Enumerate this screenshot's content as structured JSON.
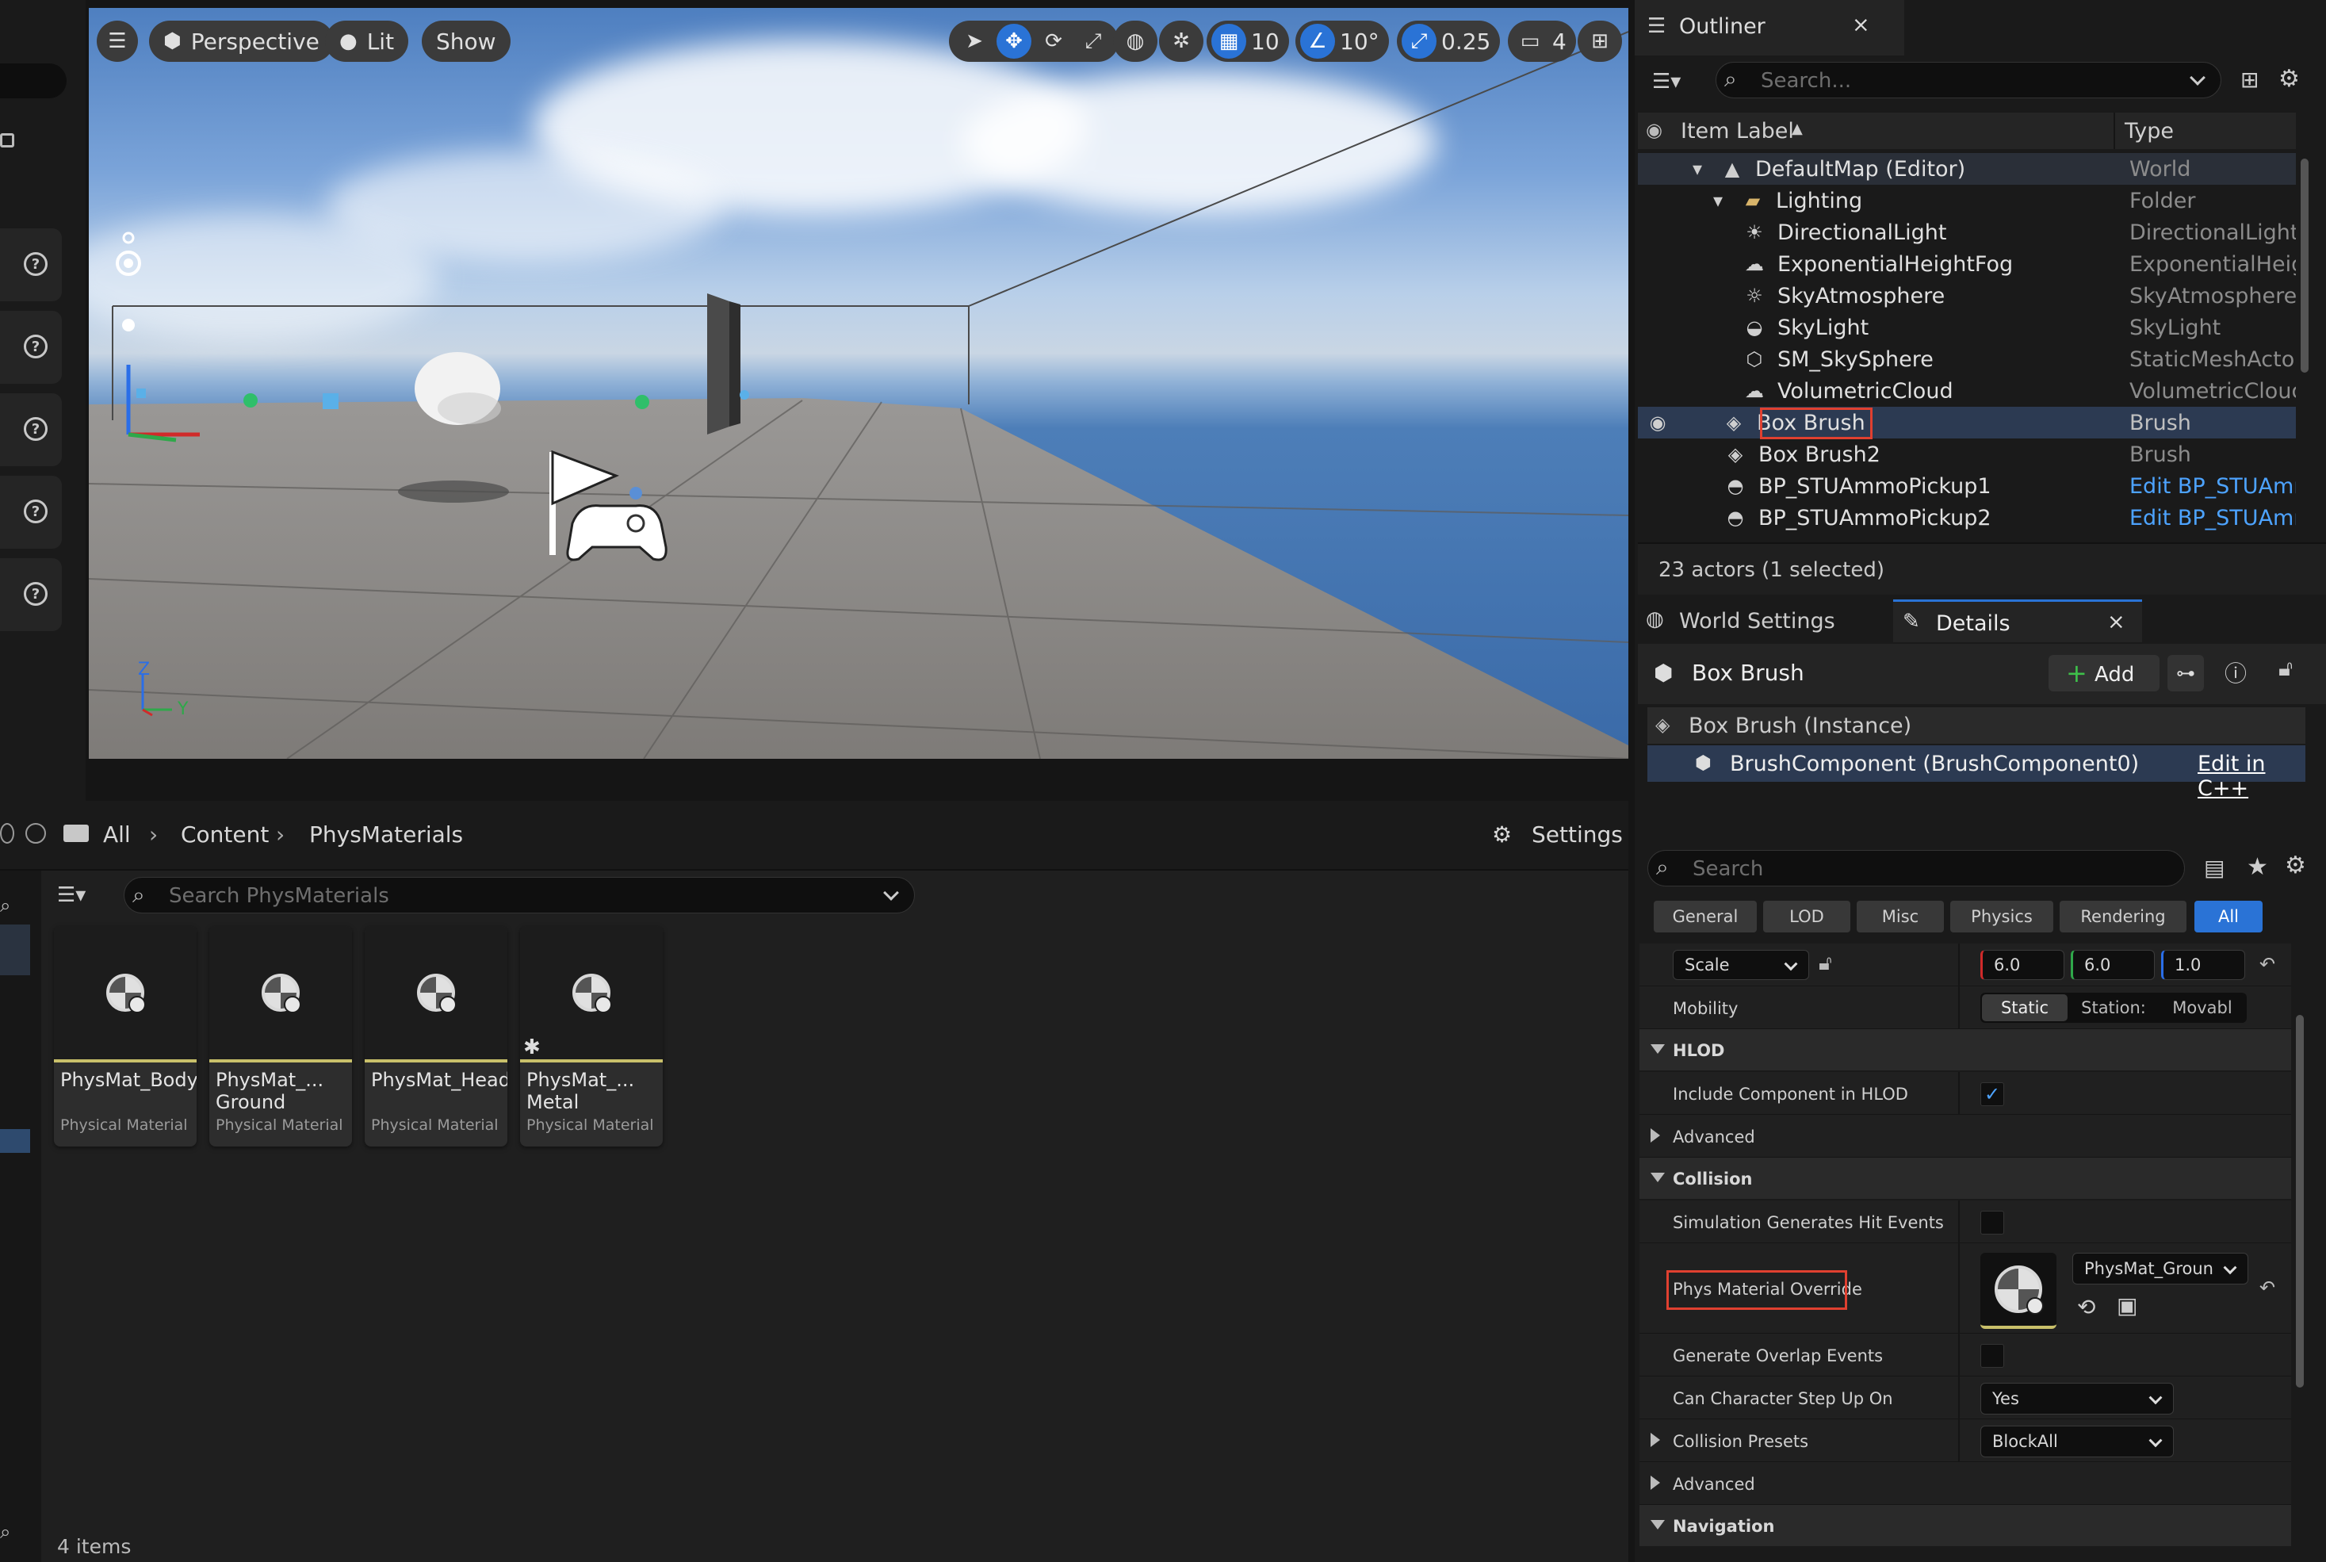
{
  "viewport": {
    "perspective_label": "Perspective",
    "lit_label": "Lit",
    "show_label": "Show",
    "grid_snap": "10",
    "rotation_snap": "10°",
    "scale_snap": "0.25",
    "camera_speed": "4",
    "axis_z": "Z",
    "axis_y": "Y"
  },
  "outliner": {
    "title": "Outliner",
    "search_placeholder": "Search...",
    "col_label": "Item Label",
    "col_type": "Type",
    "items": [
      {
        "label": "DefaultMap (Editor)",
        "type": "World",
        "icon": "map-icon"
      },
      {
        "label": "Lighting",
        "type": "Folder",
        "icon": "folder-icon"
      },
      {
        "label": "DirectionalLight",
        "type": "DirectionalLight",
        "icon": "sun-icon"
      },
      {
        "label": "ExponentialHeightFog",
        "type": "ExponentialHeigh",
        "icon": "fog-icon"
      },
      {
        "label": "SkyAtmosphere",
        "type": "SkyAtmosphere",
        "icon": "sky-icon"
      },
      {
        "label": "SkyLight",
        "type": "SkyLight",
        "icon": "skylight-icon"
      },
      {
        "label": "SM_SkySphere",
        "type": "StaticMeshActor",
        "icon": "mesh-icon"
      },
      {
        "label": "VolumetricCloud",
        "type": "VolumetricCloud",
        "icon": "cloud-icon"
      },
      {
        "label": "Box Brush",
        "type": "Brush",
        "icon": "brush-icon"
      },
      {
        "label": "Box Brush2",
        "type": "Brush",
        "icon": "brush-icon"
      },
      {
        "label": "BP_STUAmmoPickup1",
        "type": "Edit BP_STUAmn",
        "icon": "actor-icon"
      },
      {
        "label": "BP_STUAmmoPickup2",
        "type": "Edit BP_STUAmn",
        "icon": "actor-icon"
      }
    ],
    "status": "23 actors (1 selected)"
  },
  "tabs": {
    "world_settings": "World Settings",
    "details": "Details"
  },
  "details": {
    "actor_name": "Box Brush",
    "add_label": "Add",
    "instance_label": "Box Brush (Instance)",
    "component_label": "BrushComponent (BrushComponent0)",
    "edit_cpp": "Edit in C++",
    "search_placeholder": "Search",
    "filter_tabs": [
      "General",
      "LOD",
      "Misc",
      "Physics",
      "Rendering",
      "All"
    ],
    "scale_label": "Scale",
    "scale_x": "6.0",
    "scale_y": "6.0",
    "scale_z": "1.0",
    "mobility_label": "Mobility",
    "mobility_options": [
      "Static",
      "Station:",
      "Movabl"
    ],
    "hlod_section": "HLOD",
    "include_hlod": "Include Component in HLOD",
    "advanced": "Advanced",
    "collision_section": "Collision",
    "sim_hit_events": "Simulation Generates Hit Events",
    "phys_override": "Phys Material Override",
    "phys_value": "PhysMat_Groun",
    "overlap_events": "Generate Overlap Events",
    "step_up": "Can Character Step Up On",
    "step_up_value": "Yes",
    "collision_presets": "Collision Presets",
    "presets_value": "BlockAll",
    "advanced2": "Advanced",
    "navigation_section": "Navigation"
  },
  "content_browser": {
    "crumb_all": "All",
    "crumb_content": "Content",
    "crumb_folder": "PhysMaterials",
    "settings_label": "Settings",
    "search_placeholder": "Search PhysMaterials",
    "assets": [
      {
        "name": "PhysMat_Body",
        "type": "Physical Material"
      },
      {
        "name": "PhysMat_...\nGround",
        "type": "Physical Material"
      },
      {
        "name": "PhysMat_Head",
        "type": "Physical Material"
      },
      {
        "name": "PhysMat_...\nMetal",
        "type": "Physical Material"
      }
    ],
    "items_count": "4 items"
  }
}
